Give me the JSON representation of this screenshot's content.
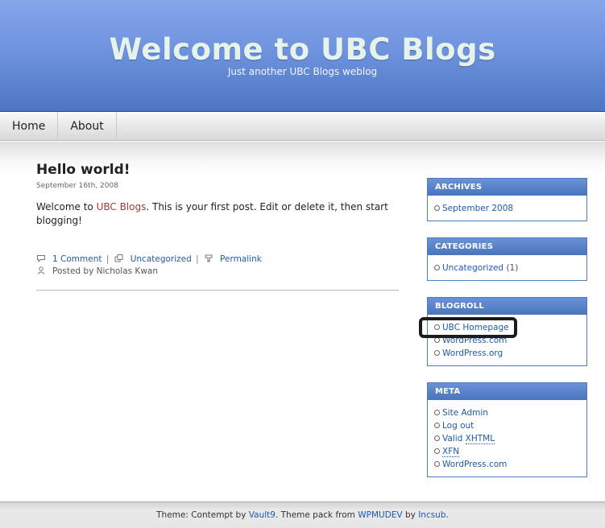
{
  "header": {
    "title": "Welcome to UBC Blogs",
    "tagline": "Just another UBC Blogs weblog"
  },
  "nav": {
    "items": [
      {
        "label": "Home"
      },
      {
        "label": "About"
      }
    ]
  },
  "post": {
    "title": "Hello world!",
    "date": "September 16th, 2008",
    "body_before": "Welcome to ",
    "body_link": "UBC Blogs",
    "body_after": ". This is your first post. Edit or delete it, then start blogging!",
    "comments_link": "1 Comment",
    "category_link": "Uncategorized",
    "permalink": "Permalink",
    "separator": "|",
    "posted_by": "Posted by Nicholas Kwan"
  },
  "sidebar": {
    "archives": {
      "title": "ARCHIVES",
      "items": [
        {
          "label": "September 2008"
        }
      ]
    },
    "categories": {
      "title": "CATEGORIES",
      "items": [
        {
          "label": "Uncategorized",
          "count": "(1)"
        }
      ]
    },
    "blogroll": {
      "title": "BLOGROLL",
      "items": [
        {
          "label": "UBC Homepage"
        },
        {
          "label": "WordPress.com"
        },
        {
          "label": "WordPress.org"
        }
      ]
    },
    "meta": {
      "title": "META",
      "items": [
        {
          "label": "Site Admin"
        },
        {
          "label": "Log out"
        },
        {
          "label_prefix": "Valid ",
          "label_abbr": "XHTML"
        },
        {
          "label_abbr": "XFN"
        },
        {
          "label": "WordPress.com"
        }
      ]
    }
  },
  "footer": {
    "text1": "Theme: Contempt by ",
    "link1": "Vault9",
    "text2": ". Theme pack from ",
    "link2": "WPMUDEV",
    "text3": " by ",
    "link3": "Incsub",
    "text4": "."
  },
  "colors": {
    "header_top": "#86a6ea",
    "header_bottom": "#4d76c4",
    "title_text": "#e6f3ea",
    "link": "#1e5aa8",
    "post_link": "#a63a3a",
    "widget_header": "#4a74bd"
  }
}
